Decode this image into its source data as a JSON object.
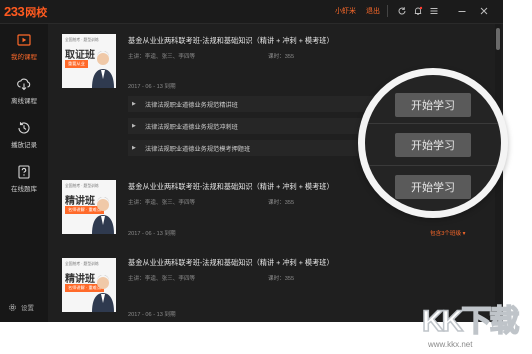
{
  "app": {
    "logo_num": "233",
    "logo_cn": "网校",
    "user_name": "小虾米",
    "logout_label": "退出",
    "accent": "#ff6a2a"
  },
  "sidebar": {
    "items": [
      {
        "label": "我的课程",
        "icon": "video-play-icon",
        "active": true
      },
      {
        "label": "离线课程",
        "icon": "cloud-download-icon",
        "active": false
      },
      {
        "label": "播放记录",
        "icon": "clock-history-icon",
        "active": false
      },
      {
        "label": "在线题库",
        "icon": "question-bank-icon",
        "active": false
      }
    ],
    "settings_label": "设置"
  },
  "courses": [
    {
      "thumb_tag": "全国统考 · 题型训练",
      "thumb_title": "取证班",
      "thumb_badge": "重要从业",
      "title": "基金从业业两科联考班-法规和基础知识（精讲 + 冲刺 + 模考班）",
      "teachers": "主讲：李逵、张三、李四等",
      "hours": "课时：355",
      "date": "2017 - 06 - 13 到期",
      "chapters": [
        "法律法规职业道德业务规范精讲班",
        "法律法规职业道德业务规范冲刺班",
        "法律法规职业道德业务规范模考押题班"
      ]
    },
    {
      "thumb_tag": "全国统考 · 题型训练",
      "thumb_title": "精讲班",
      "thumb_badge": "名师讲解 · 重难点",
      "title": "基金从业业两科联考班-法规和基础知识（精讲 + 冲刺 + 模考班）",
      "teachers": "主讲：李逵、张三、李四等",
      "hours": "课时：355",
      "date": "2017 - 06 - 13 到期",
      "more": "包含3个班级 ▾"
    },
    {
      "thumb_tag": "全国统考 · 题型训练",
      "thumb_title": "精讲班",
      "thumb_badge": "名师讲解 · 重难点",
      "title": "基金从业业两科联考班-法规和基础知识（精讲 + 冲刺 + 模考班）",
      "teachers": "主讲：李逵、张三、李四等",
      "hours": "课时：355",
      "date": "2017 - 06 - 13 到期"
    }
  ],
  "magnifier": {
    "buttons": [
      "开始学习",
      "开始学习",
      "开始学习"
    ]
  },
  "watermark": {
    "text": "KK下载",
    "url": "www.kkx.net"
  }
}
